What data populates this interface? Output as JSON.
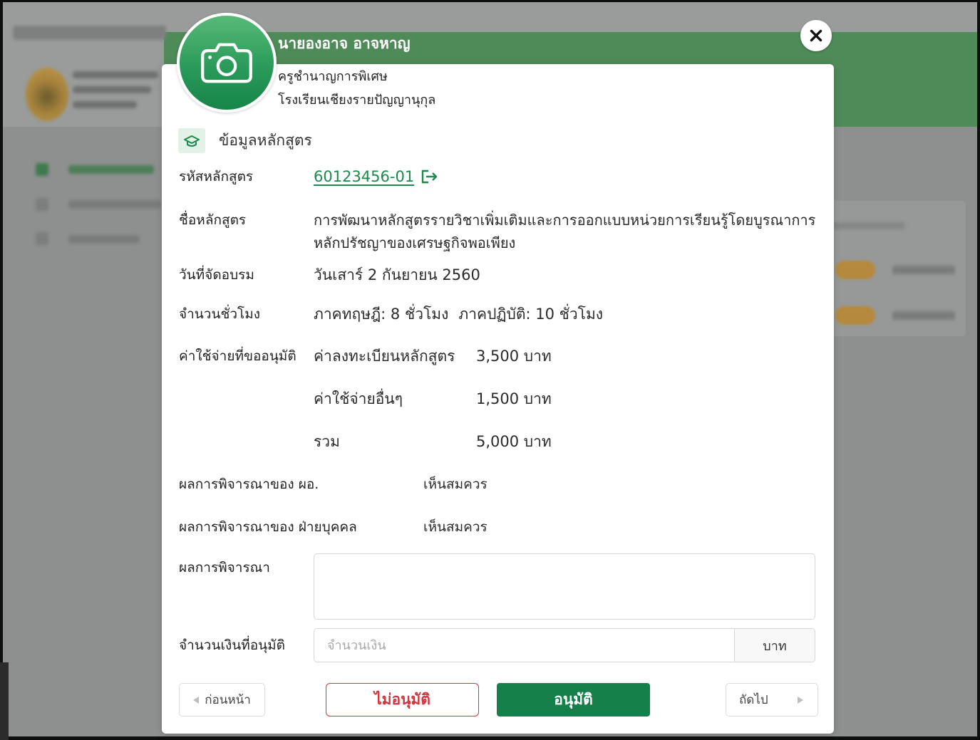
{
  "theme": {
    "overlay": "#8e908f",
    "banner_green": "#4f8b59",
    "brand_green": "#1b8a4b",
    "approve_green": "#15804a",
    "reject_red": "#d4343b",
    "text": "#222222"
  },
  "modal": {
    "close_icon": "close-icon",
    "profile": {
      "avatar_icon": "camera-icon",
      "name": "นายองอาจ อาจหาญ",
      "position": "ครูชำนาญการพิเศษ",
      "school": "โรงเรียนเชียงรายปัญญานุกุล"
    },
    "section": {
      "icon": "graduation-cap-icon",
      "title": "ข้อมูลหลักสูตร"
    },
    "course": {
      "code": {
        "label": "รหัสหลักสูตร",
        "value": "60123456-01",
        "icon": "external-link-icon"
      },
      "name": {
        "label": "ชื่อหลักสูตร",
        "value": "การพัฒนาหลักสูตรรายวิชาเพิ่มเติมและการออกแบบหน่วยการเรียนรู้โดยบูรณาการหลักปรัชญาของเศรษฐกิจพอเพียง"
      },
      "training_date": {
        "label": "วันที่จัดอบรม",
        "value": "วันเสาร์ 2 กันยายน 2560"
      },
      "hours": {
        "label": "จำนวนชั่วโมง",
        "theory": "ภาคทฤษฎี: 8 ชั่วโมง",
        "practice": "ภาคปฏิบัติ: 10 ชั่วโมง"
      },
      "expenses": {
        "label": "ค่าใช้จ่ายที่ขออนุมัติ",
        "items": [
          {
            "name": "ค่าลงทะเบียนหลักสูตร",
            "amount": "3,500 บาท"
          },
          {
            "name": "ค่าใช้จ่ายอื่นๆ",
            "amount": "1,500 บาท"
          },
          {
            "name": "รวม",
            "amount": "5,000 บาท"
          }
        ]
      }
    },
    "reviews": [
      {
        "label": "ผลการพิจารณาของ ผอ.",
        "value": "เห็นสมควร"
      },
      {
        "label": "ผลการพิจารณาของ ฝ่ายบุคคล",
        "value": "เห็นสมควร"
      }
    ],
    "decision": {
      "label": "ผลการพิจารณา",
      "value": ""
    },
    "approved_amount": {
      "label": "จำนวนเงินที่อนุมัติ",
      "placeholder": "จำนวนเงิน",
      "value": "",
      "unit": "บาท"
    },
    "footer": {
      "prev_label": "ก่อนหน้า",
      "prev_icon": "triangle-left-icon",
      "reject_label": "ไม่อนุมัติ",
      "approve_label": "อนุมัติ",
      "next_label": "ถัดไป",
      "next_icon": "triangle-right-icon"
    }
  }
}
